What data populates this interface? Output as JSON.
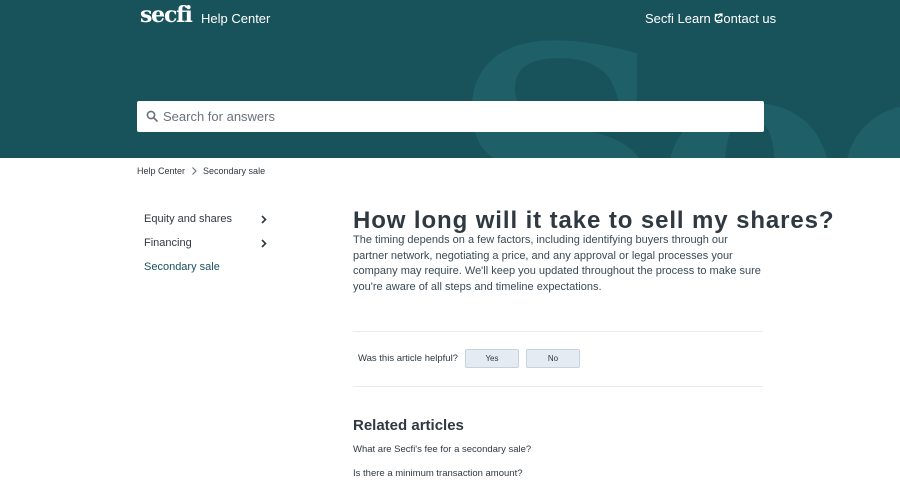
{
  "colors": {
    "hero_bg": "#18535c",
    "hero_watermark": "#1f5f68",
    "text": "#2f3941",
    "button_bg": "#e4ebf2",
    "divider": "#e9ebed"
  },
  "header": {
    "logo": "secfi",
    "help_center": "Help Center",
    "secfi_learn": "Secfi Learn",
    "contact_us": "Contact us",
    "watermark": "Secf"
  },
  "search": {
    "placeholder": "Search for answers",
    "value": ""
  },
  "breadcrumb": {
    "items": [
      "Help Center",
      "Secondary sale"
    ]
  },
  "sidebar": {
    "items": [
      {
        "label": "Equity and shares",
        "has_chevron": true
      },
      {
        "label": "Financing",
        "has_chevron": true
      },
      {
        "label": "Secondary sale",
        "has_chevron": false
      }
    ]
  },
  "article": {
    "title": "How long will it take to sell my shares?",
    "body": "The timing depends on a few factors, including identifying buyers through our partner network, negotiating a price, and any approval or legal processes your company may require. We'll keep you updated throughout the process to make sure you're aware of all steps and timeline expectations."
  },
  "feedback": {
    "question": "Was this article helpful?",
    "yes": "Yes",
    "no": "No"
  },
  "related": {
    "title": "Related articles",
    "items": [
      "What are Secfi's fee for a secondary sale?",
      "Is there a minimum transaction amount?"
    ]
  }
}
